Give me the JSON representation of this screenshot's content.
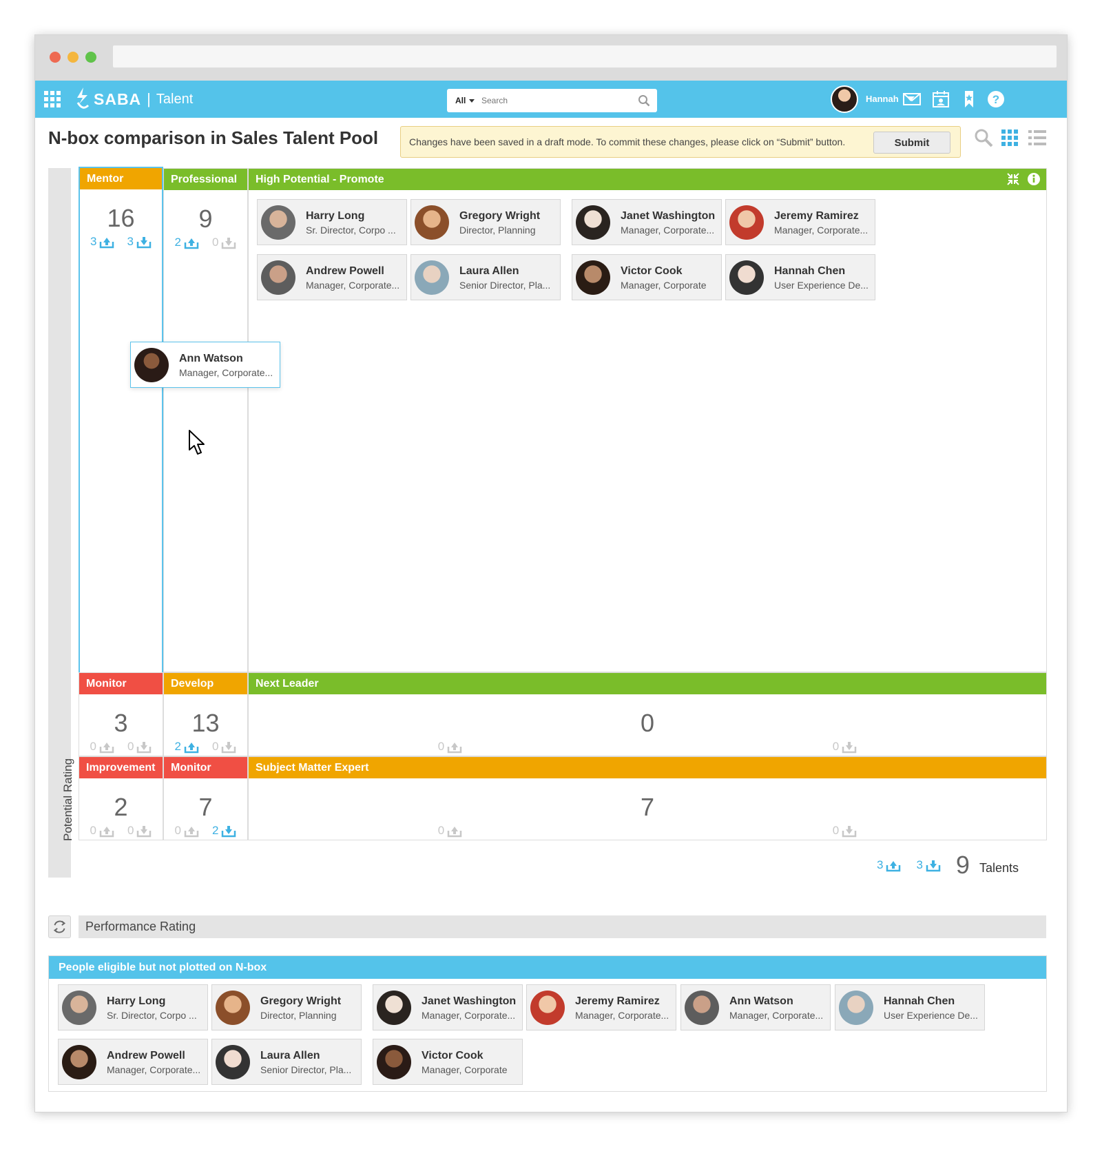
{
  "app": {
    "brand": "SABA",
    "product": "Talent",
    "search_scope": "All",
    "search_placeholder": "Search",
    "user_name": "Hannah"
  },
  "page": {
    "title": "N-box comparison in Sales Talent Pool",
    "notice": "Changes have been saved in a draft mode. To commit these changes, please click on “Submit” button.",
    "submit_label": "Submit",
    "y_axis_label": "Potential Rating",
    "x_axis_label": "Performance Rating"
  },
  "colors": {
    "appbar": "#54c3ea",
    "orange": "#f0a500",
    "green": "#7abd2a",
    "red": "#f04f44",
    "accent_blue": "#3eb1e2"
  },
  "grid": {
    "cells": [
      {
        "id": "mentor",
        "label": "Mentor",
        "color": "#f0a500",
        "count": "16",
        "up": "3",
        "down": "3",
        "up_active": true,
        "down_active": true
      },
      {
        "id": "professional",
        "label": "Professional",
        "color": "#7abd2a",
        "count": "9",
        "up": "2",
        "down": "0",
        "up_active": true,
        "down_active": false
      },
      {
        "id": "high-potential",
        "label": "High Potential - Promote",
        "color": "#7abd2a",
        "count": "9",
        "up": "3",
        "down": "3",
        "up_active": true,
        "down_active": true,
        "count_suffix": "Talents"
      },
      {
        "id": "monitor-mid",
        "label": "Monitor",
        "color": "#f04f44",
        "count": "3",
        "up": "0",
        "down": "0",
        "up_active": false,
        "down_active": false
      },
      {
        "id": "develop",
        "label": "Develop",
        "color": "#f0a500",
        "count": "13",
        "up": "2",
        "down": "0",
        "up_active": true,
        "down_active": false
      },
      {
        "id": "next-leader",
        "label": "Next Leader",
        "color": "#7abd2a",
        "count": "0",
        "up": "0",
        "down": "0",
        "up_active": false,
        "down_active": false
      },
      {
        "id": "improvement",
        "label": "Improvement",
        "color": "#f04f44",
        "count": "2",
        "up": "0",
        "down": "0",
        "up_active": false,
        "down_active": false
      },
      {
        "id": "monitor-low",
        "label": "Monitor",
        "color": "#f04f44",
        "count": "7",
        "up": "0",
        "down": "2",
        "up_active": false,
        "down_active": true
      },
      {
        "id": "sme",
        "label": "Subject Matter Expert",
        "color": "#f0a500",
        "count": "7",
        "up": "0",
        "down": "0",
        "up_active": false,
        "down_active": false
      }
    ],
    "high_potential_people": [
      {
        "name": "Harry Long",
        "role": "Sr. Director, Corpo ...",
        "avatar_icon": "person-photo"
      },
      {
        "name": "Gregory Wright",
        "role": "Director, Planning",
        "avatar_icon": "person-photo"
      },
      {
        "name": "Janet Washington",
        "role": "Manager, Corporate...",
        "avatar_icon": "person-photo"
      },
      {
        "name": "Jeremy Ramirez",
        "role": "Manager, Corporate...",
        "avatar_icon": "person-photo"
      },
      {
        "name": "Andrew Powell",
        "role": "Manager, Corporate...",
        "avatar_icon": "person-photo"
      },
      {
        "name": "Laura Allen",
        "role": "Senior Director, Pla...",
        "avatar_icon": "person-photo"
      },
      {
        "name": "Victor Cook",
        "role": "Manager, Corporate",
        "avatar_icon": "person-photo"
      },
      {
        "name": "Hannah Chen",
        "role": "User Experience De...",
        "avatar_icon": "person-photo"
      }
    ],
    "dragged_card": {
      "name": "Ann Watson",
      "role": "Manager, Corporate..."
    }
  },
  "eligible": {
    "title": "People eligible but not plotted on N-box",
    "people": [
      {
        "name": "Harry Long",
        "role": "Sr. Director, Corpo ..."
      },
      {
        "name": "Gregory Wright",
        "role": "Director, Planning"
      },
      {
        "name": "Janet Washington",
        "role": "Manager, Corporate..."
      },
      {
        "name": "Jeremy Ramirez",
        "role": "Manager, Corporate..."
      },
      {
        "name": "Ann Watson",
        "role": "Manager, Corporate..."
      },
      {
        "name": "Hannah Chen",
        "role": "User Experience De..."
      },
      {
        "name": "Andrew Powell",
        "role": "Manager, Corporate..."
      },
      {
        "name": "Laura Allen",
        "role": "Senior Director, Pla..."
      },
      {
        "name": "Victor Cook",
        "role": "Manager, Corporate"
      }
    ]
  }
}
